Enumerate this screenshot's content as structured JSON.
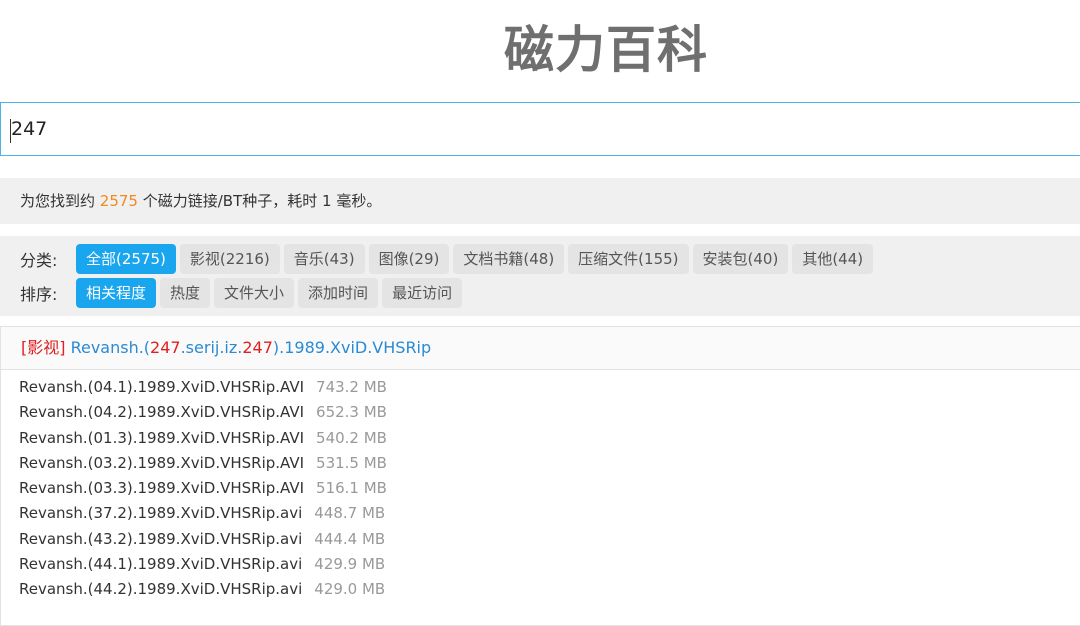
{
  "site": {
    "logo": "磁力百科"
  },
  "search": {
    "value": "247"
  },
  "summary": {
    "prefix": "为您找到约 ",
    "count": "2575",
    "suffix": " 个磁力链接/BT种子，耗时 1 毫秒。"
  },
  "filters": {
    "category_label": "分类:",
    "categories": [
      {
        "label": "全部(2575)",
        "active": true
      },
      {
        "label": "影视(2216)",
        "active": false
      },
      {
        "label": "音乐(43)",
        "active": false
      },
      {
        "label": "图像(29)",
        "active": false
      },
      {
        "label": "文档书籍(48)",
        "active": false
      },
      {
        "label": "压缩文件(155)",
        "active": false
      },
      {
        "label": "安装包(40)",
        "active": false
      },
      {
        "label": "其他(44)",
        "active": false
      }
    ],
    "sort_label": "排序:",
    "sorts": [
      {
        "label": "相关程度",
        "active": true
      },
      {
        "label": "热度",
        "active": false
      },
      {
        "label": "文件大小",
        "active": false
      },
      {
        "label": "添加时间",
        "active": false
      },
      {
        "label": "最近访问",
        "active": false
      }
    ]
  },
  "result": {
    "category_tag": "[影视]",
    "title_parts": {
      "p1": " Revansh.(",
      "hl1": "247",
      "p2": ".serij.iz.",
      "hl2": "247",
      "p3": ").1989.XviD.VHSRip"
    },
    "files": [
      {
        "name": "Revansh.(04.1).1989.XviD.VHSRip.AVI",
        "size": "743.2 MB"
      },
      {
        "name": "Revansh.(04.2).1989.XviD.VHSRip.AVI",
        "size": "652.3 MB"
      },
      {
        "name": "Revansh.(01.3).1989.XviD.VHSRip.AVI",
        "size": "540.2 MB"
      },
      {
        "name": "Revansh.(03.2).1989.XviD.VHSRip.AVI",
        "size": "531.5 MB"
      },
      {
        "name": "Revansh.(03.3).1989.XviD.VHSRip.AVI",
        "size": "516.1 MB"
      },
      {
        "name": "Revansh.(37.2).1989.XviD.VHSRip.avi",
        "size": "448.7 MB"
      },
      {
        "name": "Revansh.(43.2).1989.XviD.VHSRip.avi",
        "size": "444.4 MB"
      },
      {
        "name": "Revansh.(44.1).1989.XviD.VHSRip.avi",
        "size": "429.9 MB"
      },
      {
        "name": "Revansh.(44.2).1989.XviD.VHSRip.avi",
        "size": "429.0 MB"
      }
    ]
  }
}
